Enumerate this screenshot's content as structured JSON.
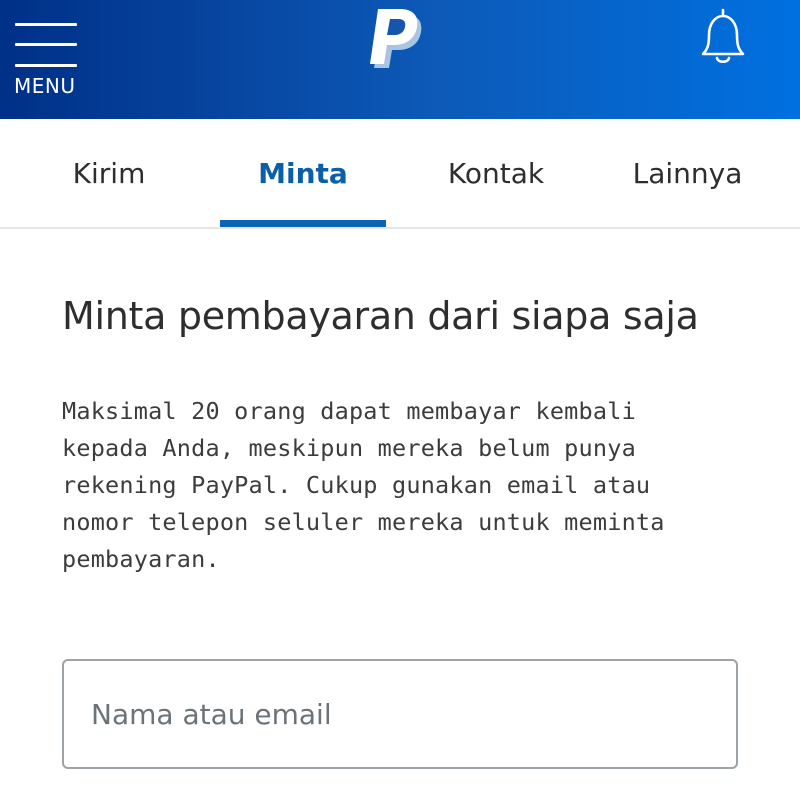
{
  "header": {
    "menu_label": "MENU",
    "logo_icon": "paypal-logo",
    "notification_icon": "bell-icon",
    "gradient_start": "#003087",
    "gradient_end": "#0070e0"
  },
  "tabs": [
    {
      "label": "Kirim",
      "active": false
    },
    {
      "label": "Minta",
      "active": true
    },
    {
      "label": "Kontak",
      "active": false
    },
    {
      "label": "Lainnya",
      "active": false
    }
  ],
  "accent_color": "#0b64b5",
  "main": {
    "title": "Minta pembayaran dari siapa saja",
    "description_lines": [
      "Maksimal 20 orang dapat membayar kembali",
      "kepada Anda, meskipun mereka belum punya",
      "rekening PayPal. Cukup gunakan email atau",
      "nomor telepon seluler mereka untuk meminta",
      "pembayaran."
    ],
    "recipient_input": {
      "placeholder": "Nama atau email",
      "value": ""
    }
  }
}
